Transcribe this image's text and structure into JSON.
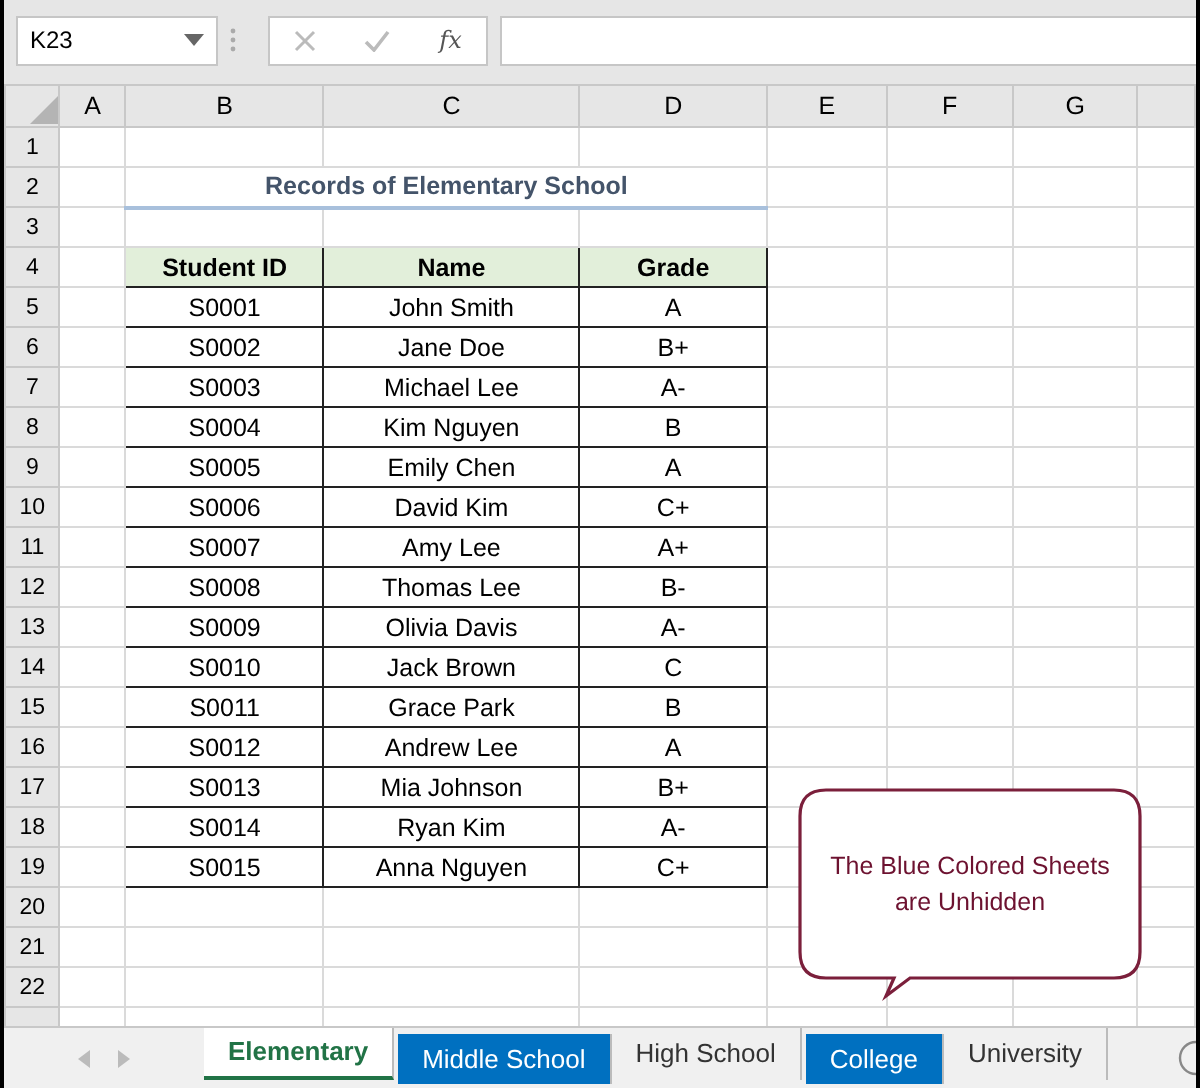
{
  "name_box": {
    "value": "K23"
  },
  "formula_bar": {
    "function_label": "fx"
  },
  "columns": [
    "A",
    "B",
    "C",
    "D",
    "E",
    "F",
    "G"
  ],
  "rows": [
    "1",
    "2",
    "3",
    "4",
    "5",
    "6",
    "7",
    "8",
    "9",
    "10",
    "11",
    "12",
    "13",
    "14",
    "15",
    "16",
    "17",
    "18",
    "19",
    "20",
    "21",
    "22"
  ],
  "title": "Records of Elementary School",
  "table": {
    "columns": [
      "Student ID",
      "Name",
      "Grade"
    ],
    "rows": [
      [
        "S0001",
        "John Smith",
        "A"
      ],
      [
        "S0002",
        "Jane Doe",
        "B+"
      ],
      [
        "S0003",
        "Michael Lee",
        "A-"
      ],
      [
        "S0004",
        "Kim Nguyen",
        "B"
      ],
      [
        "S0005",
        "Emily Chen",
        "A"
      ],
      [
        "S0006",
        "David Kim",
        "C+"
      ],
      [
        "S0007",
        "Amy Lee",
        "A+"
      ],
      [
        "S0008",
        "Thomas Lee",
        "B-"
      ],
      [
        "S0009",
        "Olivia Davis",
        "A-"
      ],
      [
        "S0010",
        "Jack Brown",
        "C"
      ],
      [
        "S0011",
        "Grace Park",
        "B"
      ],
      [
        "S0012",
        "Andrew Lee",
        "A"
      ],
      [
        "S0013",
        "Mia Johnson",
        "B+"
      ],
      [
        "S0014",
        "Ryan Kim",
        "A-"
      ],
      [
        "S0015",
        "Anna Nguyen",
        "C+"
      ]
    ]
  },
  "callout": [
    "The Blue Colored Sheets",
    "are Unhidden"
  ],
  "sheet_tabs": [
    {
      "label": "Elementary",
      "selected": true
    },
    {
      "label": "Middle School",
      "selected": false,
      "color": "#0070c0"
    },
    {
      "label": "High School",
      "selected": false
    },
    {
      "label": "College",
      "selected": false,
      "color": "#0070c0"
    },
    {
      "label": "University",
      "selected": false
    }
  ]
}
